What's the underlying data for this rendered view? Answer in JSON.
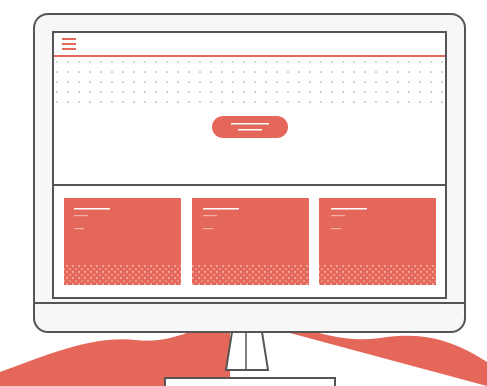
{
  "illustration": {
    "icons": [
      "hamburger-menu-icon"
    ],
    "colors": {
      "accent": "#E4675A",
      "outline": "#555555",
      "screen": "#FFFFFF",
      "bezel": "#F7F7F7",
      "dots": "#9A9A9A"
    },
    "cards": [
      {
        "name": "card-1"
      },
      {
        "name": "card-2"
      },
      {
        "name": "card-3"
      }
    ]
  }
}
